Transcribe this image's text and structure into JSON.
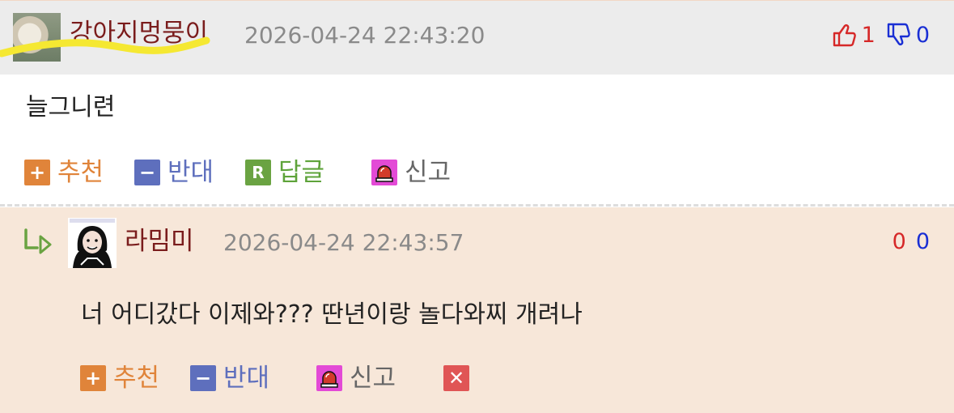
{
  "comments": [
    {
      "author": "강아지멍뭉이",
      "timestamp": "2026-04-24 22:43:20",
      "upvotes": "1",
      "downvotes": "0",
      "body": "늘그니련",
      "actions": {
        "recommend": "추천",
        "oppose": "반대",
        "reply": "답글",
        "reply_icon": "R",
        "report": "신고"
      }
    },
    {
      "author": "라밈미",
      "timestamp": "2026-04-24 22:43:57",
      "upvotes": "0",
      "downvotes": "0",
      "body": "너 어디갔다 이제와??? 딴년이랑 놀다와찌 개려나",
      "actions": {
        "recommend": "추천",
        "oppose": "반대",
        "report": "신고"
      }
    }
  ],
  "colors": {
    "header_bg": "#ececec",
    "reply_bg": "#f7e7d9",
    "author": "#7a1c1c",
    "upvote": "#d62828",
    "downvote": "#1a2fd4",
    "recommend": "#e0843a",
    "oppose": "#5e6fbd",
    "reply": "#6aa342",
    "report": "#e34ad6",
    "delete": "#e05555",
    "highlight_scribble": "#f5e832"
  }
}
